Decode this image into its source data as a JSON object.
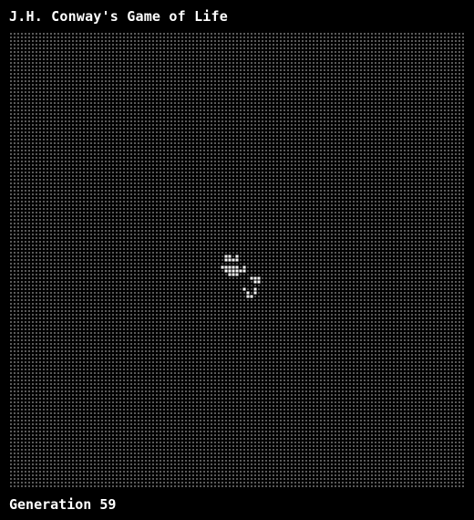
{
  "app": {
    "title": "J.H. Conway's Game of Life"
  },
  "status": {
    "generation_label": "Generation 59"
  },
  "board": {
    "columns": 125,
    "rows": 125,
    "dead_color": "#5a5a5a",
    "live_color": "#ffffff",
    "background_color": "#000000",
    "live_cells": [
      [
        59,
        61
      ],
      [
        59,
        62
      ],
      [
        60,
        61
      ],
      [
        60,
        62
      ],
      [
        61,
        62
      ],
      [
        62,
        61
      ],
      [
        62,
        62
      ],
      [
        58,
        64
      ],
      [
        59,
        64
      ],
      [
        60,
        64
      ],
      [
        61,
        64
      ],
      [
        62,
        64
      ],
      [
        64,
        64
      ],
      [
        59,
        65
      ],
      [
        60,
        65
      ],
      [
        61,
        65
      ],
      [
        62,
        65
      ],
      [
        63,
        65
      ],
      [
        64,
        65
      ],
      [
        60,
        66
      ],
      [
        61,
        66
      ],
      [
        62,
        66
      ],
      [
        66,
        67
      ],
      [
        67,
        67
      ],
      [
        68,
        67
      ],
      [
        67,
        68
      ],
      [
        68,
        68
      ],
      [
        64,
        70
      ],
      [
        65,
        71
      ],
      [
        67,
        70
      ],
      [
        67,
        71
      ],
      [
        65,
        72
      ],
      [
        66,
        72
      ]
    ]
  }
}
